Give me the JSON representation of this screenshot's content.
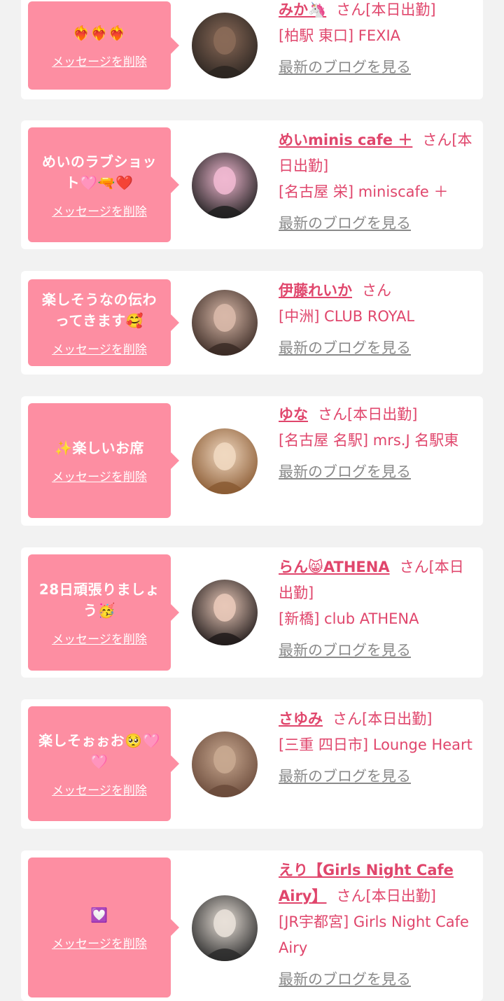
{
  "common": {
    "delete_label": "メッセージを削除",
    "blog_label": "最新のブログを見る",
    "san": "さん"
  },
  "colors": {
    "page_bg": "#f2f2f2",
    "bubble_bg": "#fd8ea2",
    "name_color": "#e0466c",
    "link_gray": "#8a8a8a"
  },
  "entries": [
    {
      "message": "❤️‍🔥❤️‍🔥❤️‍🔥",
      "name": "みか🦄",
      "status": "[本日出勤]",
      "shop": "[柏駅 東口] FEXIA",
      "avatar_icon": "avatar-photo-icon",
      "avatar_colors": [
        "#2a2420",
        "#8a6a58"
      ]
    },
    {
      "message": "めいのラブショット🩷🔫❤️",
      "name": "めいminis cafe ＋",
      "status": "[本日出勤]",
      "shop": "[名古屋 栄] miniscafe ＋",
      "avatar_icon": "avatar-photo-icon",
      "avatar_colors": [
        "#1e1e1e",
        "#f0b8d0"
      ]
    },
    {
      "message": "楽しそうなの伝わってきます🥰",
      "name": "伊藤れいか",
      "status": "",
      "shop": "[中洲] CLUB ROYAL",
      "avatar_icon": "avatar-photo-icon",
      "avatar_colors": [
        "#3a2a24",
        "#d8b8a8"
      ]
    },
    {
      "message": "✨楽しいお席",
      "name": "ゆな",
      "status": "[本日出勤]",
      "shop": "[名古屋 名駅] mrs.J 名駅東",
      "avatar_icon": "avatar-photo-icon",
      "avatar_colors": [
        "#8a5a32",
        "#f0d8c0"
      ]
    },
    {
      "message": "28日頑張りましょう🥳",
      "name": "らん😸ATHENA",
      "status": "[本日出勤]",
      "shop": "[新橋] club ATHENA",
      "avatar_icon": "avatar-photo-icon",
      "avatar_colors": [
        "#201a1a",
        "#e8c8b8"
      ]
    },
    {
      "message": "楽しそぉぉお🥺🩷🩷",
      "name": "さゆみ",
      "status": "[本日出勤]",
      "shop": "[三重 四日市] Lounge Heart",
      "avatar_icon": "avatar-photo-icon",
      "avatar_colors": [
        "#6a4a3a",
        "#c8a890"
      ]
    },
    {
      "message": "💟",
      "name": "えり【Girls Night Cafe Airy】",
      "status": "[本日出勤]",
      "shop": "[JR宇都宮] Girls Night Cafe Airy",
      "avatar_icon": "avatar-photo-icon",
      "avatar_colors": [
        "#2a2a2a",
        "#e8e0d8"
      ]
    }
  ]
}
